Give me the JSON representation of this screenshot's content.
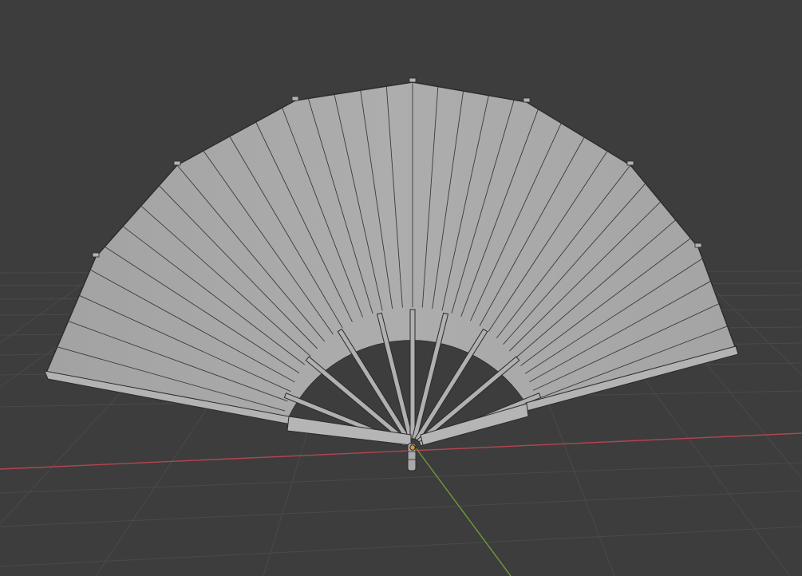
{
  "viewport": {
    "background": "#3d3d3d",
    "grid_color": "#4a4a4a",
    "x_axis_color": "#b5444f",
    "y_axis_color": "#6f9b35"
  },
  "fan": {
    "paper_color": "#a7a7a7",
    "paper_dark": "#949494",
    "outline_color": "#2b2b2b",
    "rib_color": "#b0b0b0",
    "origin_color": "#e8902a"
  }
}
